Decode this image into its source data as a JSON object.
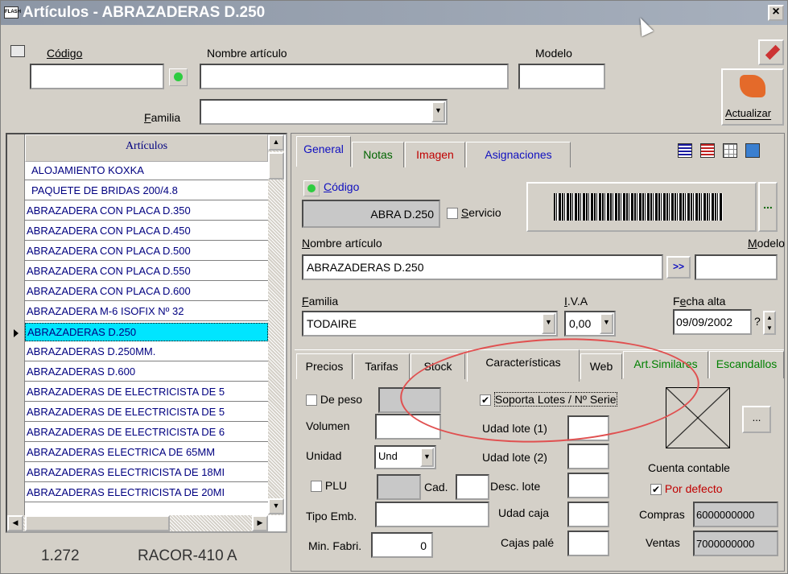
{
  "window": {
    "title": "Artículos - ABRAZADERAS D.250",
    "close": "×"
  },
  "search": {
    "codigo_label": "Código",
    "nombre_label": "Nombre artículo",
    "modelo_label": "Modelo",
    "familia_label": "Familia",
    "actualizar_label": "Actualizar"
  },
  "list": {
    "header": "Artículos",
    "items": [
      "ALOJAMIENTO KOXKA",
      "PAQUETE DE BRIDAS 200/4.8",
      "ABRAZADERA CON PLACA D.350",
      "ABRAZADERA CON PLACA D.450",
      "ABRAZADERA CON PLACA D.500",
      "ABRAZADERA CON PLACA D.550",
      "ABRAZADERA CON PLACA D.600",
      "ABRAZADERA M-6 ISOFIX Nº 32",
      "ABRAZADERAS D.250",
      "ABRAZADERAS D.250MM.",
      "ABRAZADERAS D.600",
      "ABRAZADERAS DE ELECTRICISTA DE 5",
      "ABRAZADERAS DE ELECTRICISTA DE 5",
      "ABRAZADERAS DE ELECTRICISTA DE 6",
      "ABRAZADERAS ELECTRICA DE 65MM",
      "ABRAZADERAS ELECTRICISTA DE 18MI",
      "ABRAZADERAS ELECTRICISTA DE 20MI"
    ],
    "selected_index": 8,
    "count": "1.272",
    "ref": "RACOR-410 A"
  },
  "tabs": {
    "general": "General",
    "notas": "Notas",
    "imagen": "Imagen",
    "asignaciones": "Asignaciones"
  },
  "general": {
    "codigo_label": "Código",
    "codigo_value": "ABRA D.250",
    "servicio_label": "Servicio",
    "barcode_btn": "...",
    "nombre_label": "Nombre artículo",
    "modelo_label": "Modelo",
    "nombre_value": "ABRAZADERAS D.250",
    "arrow_btn": ">>",
    "familia_label": "Familia",
    "familia_value": "TODAIRE",
    "iva_label": "I.V.A",
    "iva_value": "0,00",
    "fecha_label": "Fecha alta",
    "fecha_value": "09/09/2002",
    "fecha_q": "?"
  },
  "subtabs": {
    "precios": "Precios",
    "tarifas": "Tarifas",
    "stock": "Stock",
    "caracteristicas": "Características",
    "web": "Web",
    "similares": "Art.Similares",
    "escandallos": "Escandallos"
  },
  "caract": {
    "de_peso": "De peso",
    "volumen": "Volumen",
    "unidad": "Unidad",
    "unidad_value": "Und",
    "plu": "PLU",
    "cad": "Cad.",
    "tipo_emb": "Tipo Emb.",
    "min_fabri": "Min. Fabri.",
    "min_fabri_value": "0",
    "soporta_lotes": "Soporta Lotes / Nº Serie",
    "udad_lote1": "Udad lote (1)",
    "udad_lote2": "Udad lote (2)",
    "desc_lote": "Desc. lote",
    "udad_caja": "Udad caja",
    "cajas_pale": "Cajas palé",
    "dots": "...",
    "cuenta_contable": "Cuenta contable",
    "por_defecto": "Por defecto",
    "compras": "Compras",
    "compras_value": "6000000000",
    "ventas": "Ventas",
    "ventas_value": "7000000000"
  }
}
